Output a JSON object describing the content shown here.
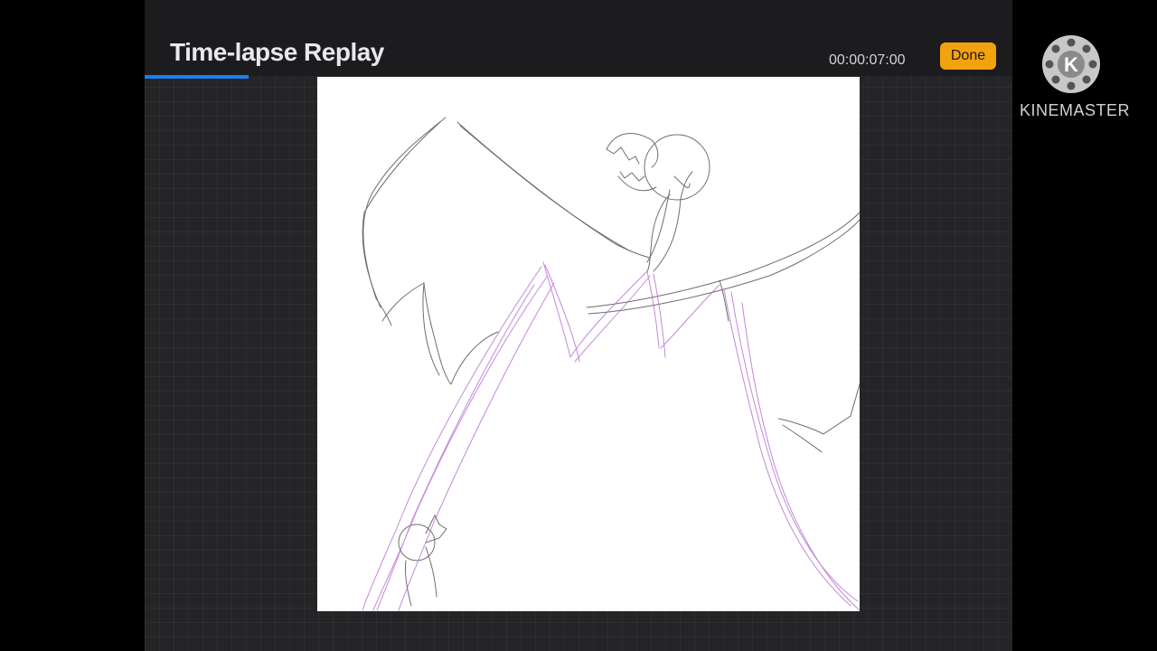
{
  "header": {
    "title": "Time-lapse Replay",
    "timestamp": "00:00:07:00",
    "done_label": "Done"
  },
  "playback": {
    "progress": 0.12
  },
  "canvas": {
    "content": "sketch of a winged dragon with a small figure at bottom-left"
  },
  "watermark": {
    "text": "KINEMASTER",
    "logo_letter": "K"
  },
  "colors": {
    "accent_progress": "#1a7ef2",
    "done_button": "#f3a20f",
    "sketch_gray": "#555555",
    "sketch_purple": "#b060d0"
  }
}
